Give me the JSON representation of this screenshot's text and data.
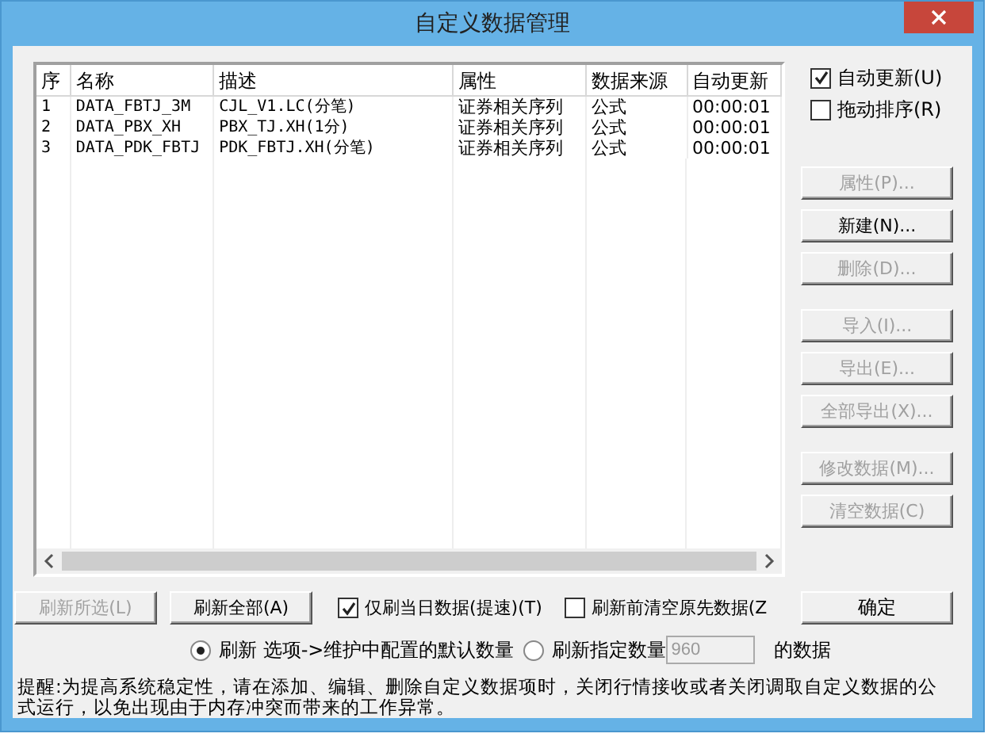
{
  "window": {
    "title": "自定义数据管理"
  },
  "table": {
    "columns": [
      "序",
      "名称",
      "描述",
      "属性",
      "数据来源",
      "自动更新"
    ],
    "rows": [
      {
        "cells": [
          "1",
          "DATA_FBTJ_3M",
          "CJL_V1.LC(分笔)",
          "证券相关序列",
          "公式",
          "00:00:01"
        ]
      },
      {
        "cells": [
          "2",
          "DATA_PBX_XH",
          "PBX_TJ.XH(1分)",
          "证券相关序列",
          "公式",
          "00:00:01"
        ]
      },
      {
        "cells": [
          "3",
          "DATA_PDK_FBTJ",
          "PDK_FBTJ.XH(分笔)",
          "证券相关序列",
          "公式",
          "00:00:01"
        ]
      }
    ]
  },
  "side_checkboxes": [
    {
      "label": "自动更新(U)",
      "checked": true
    },
    {
      "label": "拖动排序(R)",
      "checked": false
    }
  ],
  "side_button_groups": [
    [
      {
        "label": "属性(P)...",
        "disabled": true
      },
      {
        "label": "新建(N)...",
        "disabled": false
      },
      {
        "label": "删除(D)...",
        "disabled": true
      }
    ],
    [
      {
        "label": "导入(I)...",
        "disabled": true
      },
      {
        "label": "导出(E)...",
        "disabled": true
      },
      {
        "label": "全部导出(X)...",
        "disabled": true
      }
    ],
    [
      {
        "label": "修改数据(M)...",
        "disabled": true
      },
      {
        "label": "清空数据(C)",
        "disabled": true
      }
    ]
  ],
  "refresh_buttons": [
    {
      "label": "刷新所选(L)",
      "disabled": true
    },
    {
      "label": "刷新全部(A)",
      "disabled": false
    }
  ],
  "options": [
    {
      "label": "仅刷当日数据(提速)(T)",
      "checked": true
    },
    {
      "label": "刷新前清空原先数据(Z",
      "checked": false
    }
  ],
  "ok_button": "确定",
  "radios": [
    {
      "label": "刷新 选项->维护中配置的默认数量",
      "selected": true
    },
    {
      "label": "刷新指定数量",
      "selected": false
    }
  ],
  "count_field": {
    "value": "960",
    "disabled": true
  },
  "count_suffix": "的数据",
  "reminder": "提醒:为提高系统稳定性，请在添加、编辑、删除自定义数据项时，关闭行情接收或者关闭调取自定义数据的公式运行，以免出现由于内存冲突而带来的工作异常。"
}
